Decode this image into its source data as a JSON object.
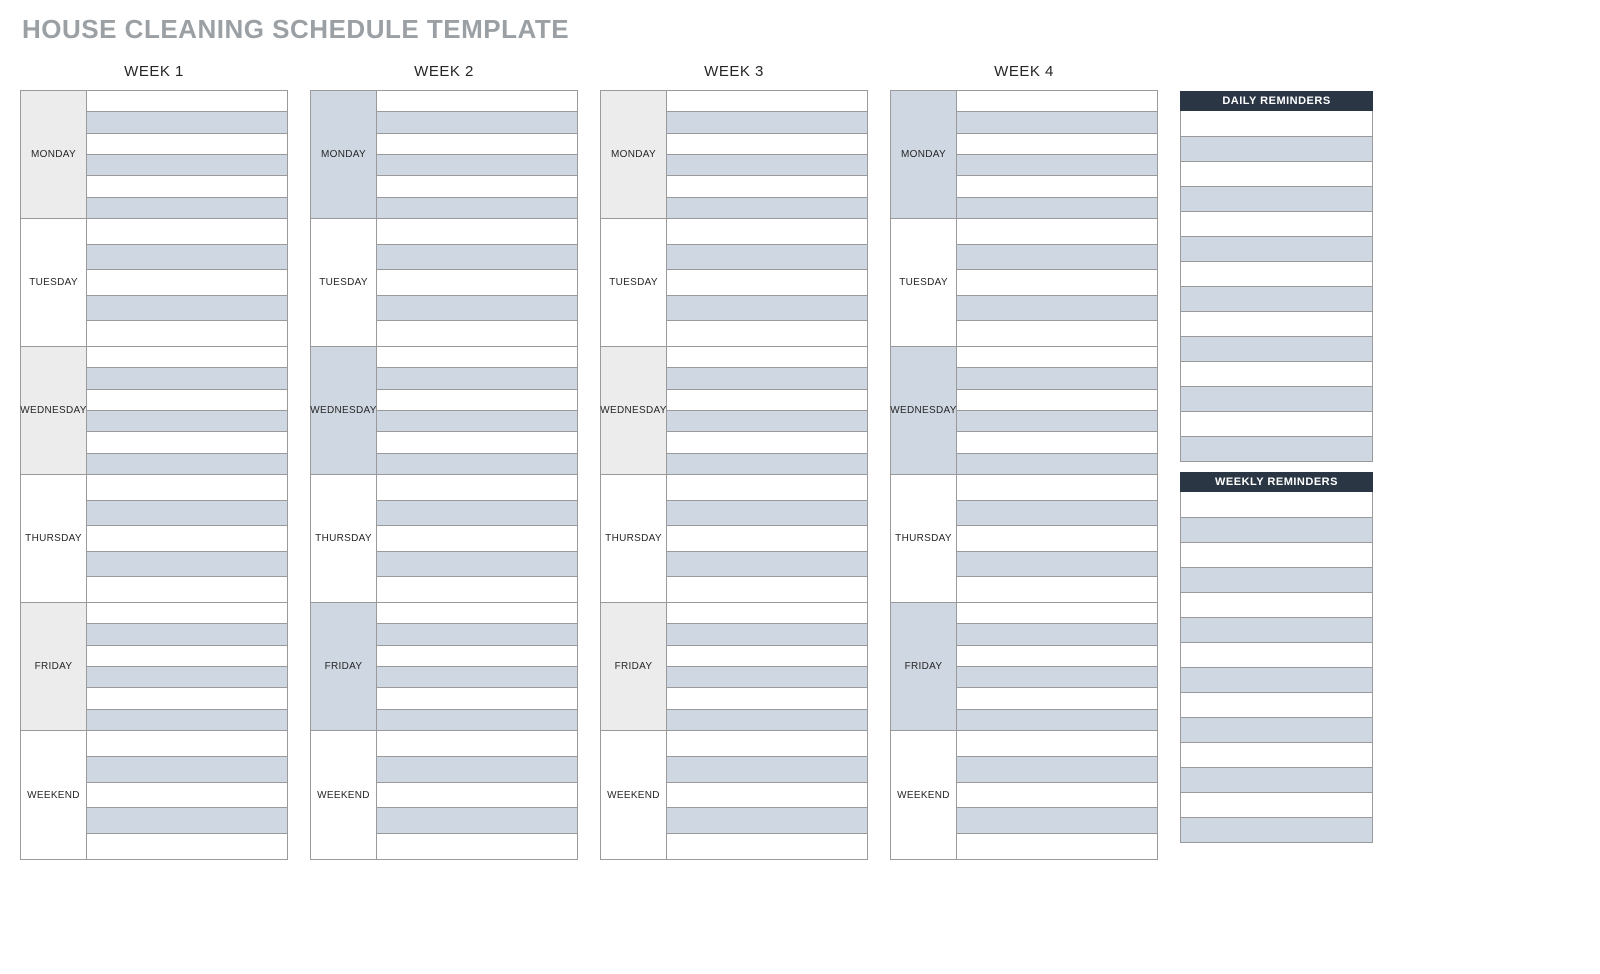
{
  "title": "HOUSE CLEANING SCHEDULE TEMPLATE",
  "weeks": [
    "WEEK 1",
    "WEEK 2",
    "WEEK 3",
    "WEEK 4"
  ],
  "days": [
    "MONDAY",
    "TUESDAY",
    "WEDNESDAY",
    "THURSDAY",
    "FRIDAY",
    "WEEKEND"
  ],
  "sidebar": {
    "daily_title": "DAILY REMINDERS",
    "weekly_title": "WEEKLY REMINDERS"
  },
  "daily_rows": 14,
  "weekly_rows": 14
}
